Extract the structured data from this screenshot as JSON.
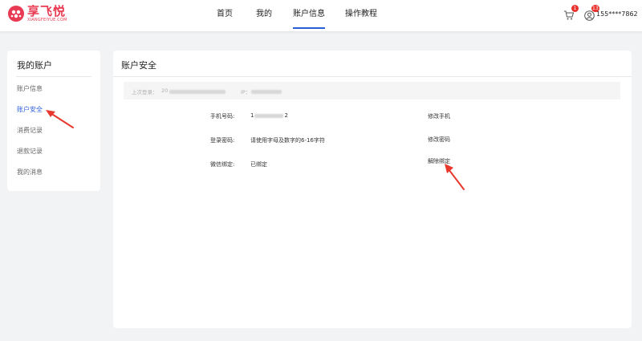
{
  "brand": {
    "name_cn": "享飞悦",
    "name_en": "XIANGFEIYUE.COM",
    "color": "#e83a52"
  },
  "nav": {
    "items": [
      {
        "label": "首页"
      },
      {
        "label": "我的"
      },
      {
        "label": "账户信息"
      },
      {
        "label": "操作教程"
      }
    ],
    "active": "账户信息",
    "active_color": "#2b5fd9"
  },
  "header": {
    "cart_icon": "cart-icon",
    "cart_badge": "1",
    "user_icon": "user-icon",
    "user_badge": "13",
    "user_phone": "155****7862"
  },
  "sidebar": {
    "title": "我的账户",
    "items": [
      {
        "label": "账户信息"
      },
      {
        "label": "账户安全"
      },
      {
        "label": "消费记录"
      },
      {
        "label": "退款记录"
      },
      {
        "label": "我的消息"
      }
    ],
    "active": "账户安全"
  },
  "main": {
    "title": "账户安全",
    "last_login_label": "上次登录：",
    "last_login_value": "20",
    "ip_label": "IP：",
    "rows": [
      {
        "label": "手机号码:",
        "value_prefix": "1",
        "value_suffix": "2",
        "action": "修改手机"
      },
      {
        "label": "登录密码:",
        "value": "请使用字母及数字的6-16字符",
        "action": "修改密码"
      },
      {
        "label": "微信绑定:",
        "value": "已绑定",
        "action": "解除绑定"
      }
    ]
  }
}
